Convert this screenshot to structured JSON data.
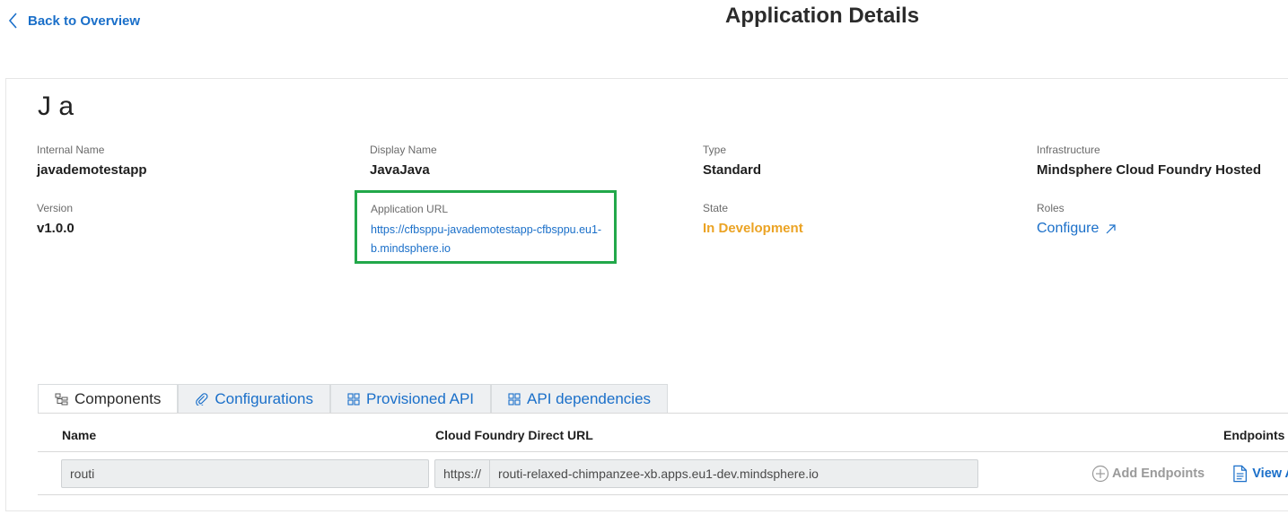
{
  "header": {
    "back_label": "Back to Overview",
    "title": "Application Details"
  },
  "app": {
    "name": "J         a",
    "fields": {
      "internal_name_label": "Internal Name",
      "internal_name_value": "javademotestapp",
      "display_name_label": "Display Name",
      "display_name_value": "JavaJava",
      "type_label": "Type",
      "type_value": "Standard",
      "infrastructure_label": "Infrastructure",
      "infrastructure_value": "Mindsphere Cloud Foundry Hosted",
      "version_label": "Version",
      "version_value": "v1.0.0",
      "url_label": "Application URL",
      "url_value": "https://cfbsppu-javademotestapp-cfbsppu.eu1-b.mindsphere.io",
      "state_label": "State",
      "state_value": "In Development",
      "roles_label": "Roles",
      "roles_value": "Configure"
    }
  },
  "tabs": [
    {
      "label": "Components",
      "icon": "tree-icon",
      "active": true
    },
    {
      "label": "Configurations",
      "icon": "paperclip-icon",
      "active": false
    },
    {
      "label": "Provisioned API",
      "icon": "grid-plus-icon",
      "active": false
    },
    {
      "label": "API dependencies",
      "icon": "grid-plus-icon",
      "active": false
    }
  ],
  "table": {
    "columns": {
      "name": "Name",
      "url": "Cloud Foundry Direct URL",
      "endpoints": "Endpoints"
    },
    "rows": [
      {
        "name": "routi",
        "url_prefix": "https://",
        "url": "routi-relaxed-chimpanzee-xb.apps.eu1-dev.mindsphere.io",
        "add_endpoints": "Add Endpoints",
        "view": "View A"
      }
    ]
  },
  "colors": {
    "accent": "#1a6fc9",
    "state": "#eba324",
    "highlight": "#22a84a"
  }
}
